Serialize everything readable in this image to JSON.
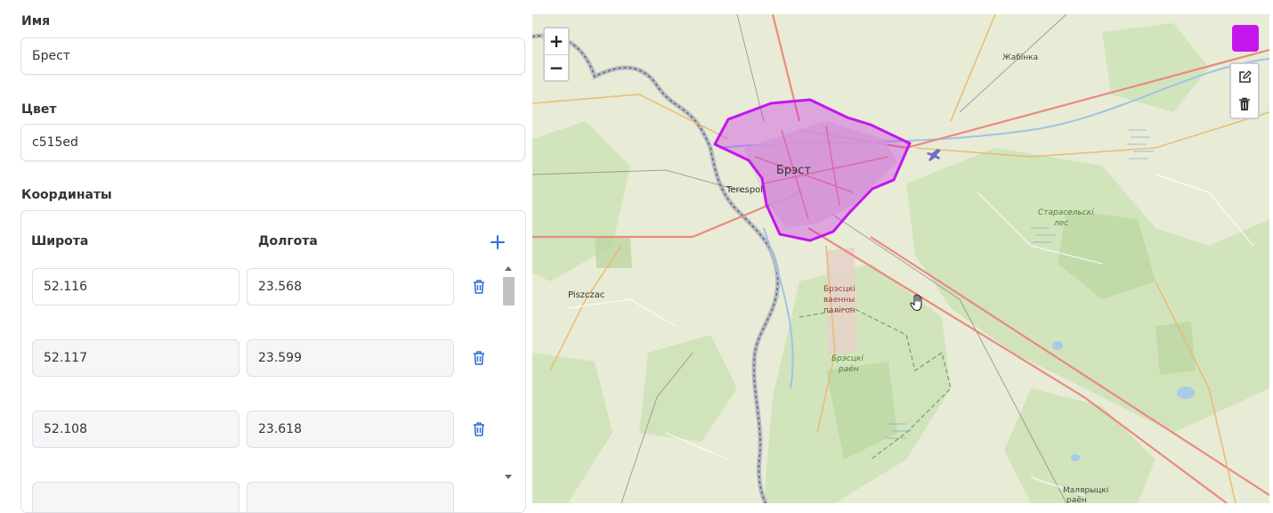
{
  "form": {
    "name_label": "Имя",
    "name_value": "Брест",
    "color_label": "Цвет",
    "color_value": "c515ed",
    "coords_label": "Координаты",
    "lat_header": "Широта",
    "lon_header": "Долгота",
    "add_icon": "plus-icon",
    "delete_icon": "trash-icon",
    "rows": [
      {
        "lat": "52.116",
        "lon": "23.568"
      },
      {
        "lat": "52.117",
        "lon": "23.599"
      },
      {
        "lat": "52.108",
        "lon": "23.618"
      },
      {
        "lat": "",
        "lon": ""
      }
    ]
  },
  "map": {
    "zoom_in": "+",
    "zoom_out": "−",
    "polygon_color": "#c515ed",
    "labels": {
      "city": "Брэст",
      "terespol": "Terespol",
      "zhabinka": "Жабінка",
      "piszczac": "Piszczac",
      "staroselskie_1": "Старасельскі",
      "staroselskie_2": "лес",
      "polygon_1": "Брэсцкі",
      "polygon_2": "ваенны",
      "polygon_3": "палігон",
      "forest_1": "Брэсцкі",
      "forest_2": "раён",
      "bottom_1": "Малярыцкі",
      "bottom_2": "раён"
    }
  },
  "colors": {
    "accent": "#2f6fd6",
    "swatch": "#c515ed"
  }
}
